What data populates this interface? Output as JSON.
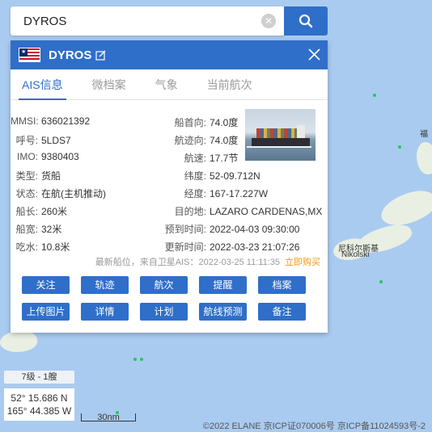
{
  "search": {
    "value": "DYROS"
  },
  "panel": {
    "ship_name": "DYROS",
    "tabs": [
      "AIS信息",
      "微档案",
      "气象",
      "当前航次"
    ],
    "info_left": [
      {
        "label": "MMSI:",
        "value": "636021392"
      },
      {
        "label": "呼号:",
        "value": "5LDS7"
      },
      {
        "label": "IMO:",
        "value": "9380403"
      },
      {
        "label": "类型:",
        "value": "货船"
      },
      {
        "label": "状态:",
        "value": "在航(主机推动)"
      },
      {
        "label": "船长:",
        "value": "260米"
      },
      {
        "label": "船宽:",
        "value": "32米"
      },
      {
        "label": "吃水:",
        "value": "10.8米"
      }
    ],
    "info_right": [
      {
        "label": "船首向:",
        "value": "74.0度"
      },
      {
        "label": "航迹向:",
        "value": "74.0度"
      },
      {
        "label": "航速:",
        "value": "17.7节"
      },
      {
        "label": "纬度:",
        "value": "52-09.712N"
      },
      {
        "label": "经度:",
        "value": "167-17.227W"
      },
      {
        "label": "目的地:",
        "value": "LAZARO CARDENAS,MX"
      },
      {
        "label": "预到时间:",
        "value": "2022-04-03 09:30:00"
      },
      {
        "label": "更新时间:",
        "value": "2022-03-23 21:07:26"
      }
    ],
    "note": "最新船位，来自卫星AIS：2022-03-25 11:11:35",
    "buy_label": "立即购买",
    "buttons": [
      "关注",
      "轨迹",
      "航次",
      "提醒",
      "档案",
      "上传图片",
      "详情",
      "计划",
      "航线预测",
      "备注"
    ]
  },
  "map": {
    "zoom_label": "7级 - 1艘",
    "lat": "52° 15.686 N",
    "lon": "165° 44.385 W",
    "scale_label": "30nm",
    "copyright": "©2022 ELANE 京ICP证070006号 京ICP备11024593号-2",
    "place_1": "尼科尔斯基",
    "place_2": "Nikolski",
    "place_3": "福"
  },
  "colors": {
    "accent": "#2f6fc9",
    "buy": "#f39a12",
    "sea": "#aacbf0"
  }
}
